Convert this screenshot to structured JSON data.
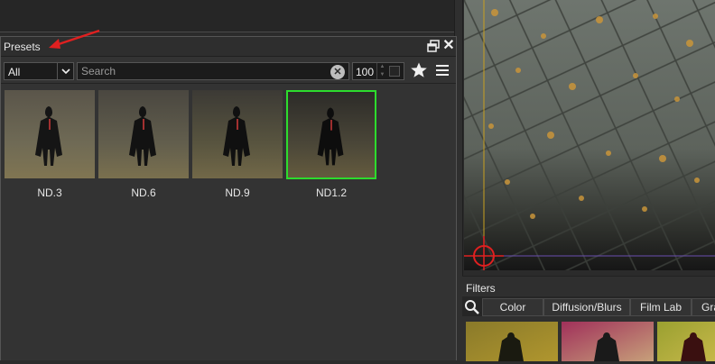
{
  "presets": {
    "title": "Presets",
    "filter_value": "All",
    "search_placeholder": "Search",
    "thumb_size": "100",
    "items": [
      {
        "label": "ND.3",
        "selected": false
      },
      {
        "label": "ND.6",
        "selected": false
      },
      {
        "label": "ND.9",
        "selected": false
      },
      {
        "label": "ND1.2",
        "selected": true
      }
    ]
  },
  "filters": {
    "title": "Filters",
    "tabs": [
      {
        "label": "Color"
      },
      {
        "label": "Diffusion/Blurs"
      },
      {
        "label": "Film Lab"
      },
      {
        "label": "Gra"
      }
    ]
  },
  "icons": {
    "float": "float-window-icon",
    "close": "close-icon",
    "dropdown": "chevron-down-icon",
    "clear": "clear-search-icon",
    "favorite": "star-icon",
    "menu": "hamburger-menu-icon",
    "search": "magnifier-icon",
    "crosshair": "crosshair-icon",
    "annotation": "red-arrow-icon"
  },
  "colors": {
    "selection": "#2ddc2d",
    "accent_red": "#e02020"
  }
}
